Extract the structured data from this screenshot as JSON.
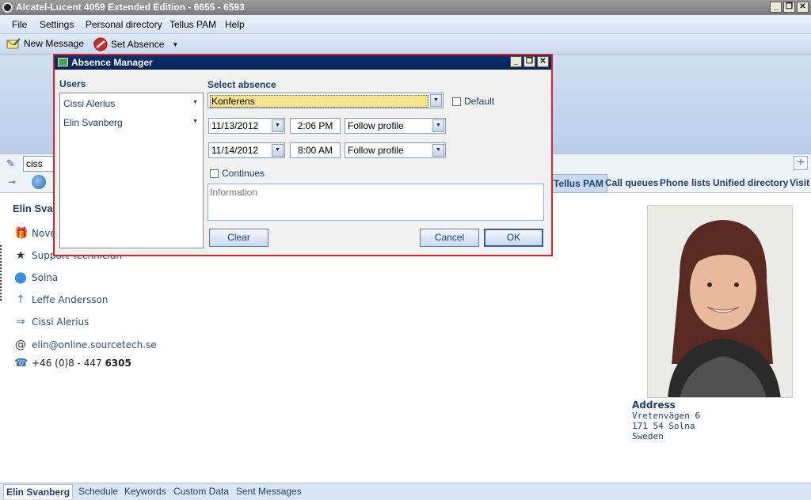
{
  "window": {
    "title": "Alcatel-Lucent 4059 Extended Edition - 6655 - 6593",
    "min": "_",
    "max": "❐",
    "close": "✕"
  },
  "menu": [
    "File",
    "Settings",
    "Personal directory",
    "Tellus PAM",
    "Help"
  ],
  "toolbar": {
    "new_message": "New Message",
    "set_absence": "Set Absence"
  },
  "search": {
    "value": "ciss"
  },
  "tabs": [
    "Tellus PAM",
    "Call queues",
    "Phone lists",
    "Unified directory",
    "Visit"
  ],
  "contact": {
    "name": "Elin Sva",
    "birthday": "Nove",
    "title": "Support Technician",
    "location": "Solna",
    "manager": "Leffe Andersson",
    "assistant": "Cissi Alerius",
    "email": "elin@online.sourcetech.se",
    "phone_prefix": "+46 (0)8 - 447 ",
    "phone_ext": "6305"
  },
  "address": {
    "title": "Address",
    "lines": [
      "Vretenvägen 6",
      "171 54 Solna",
      "Sweden"
    ]
  },
  "bottom_tabs": [
    "Elin Svanberg",
    "Schedule",
    "Keywords",
    "Custom Data",
    "Sent Messages"
  ],
  "dialog": {
    "title": "Absence Manager",
    "users_label": "Users",
    "users": [
      "Cissi Alerius",
      "Elin Svanberg"
    ],
    "select_absence_label": "Select absence",
    "absence_value": "Konferens",
    "default_label": "Default",
    "start_date": "11/13/2012",
    "start_time": "2:06 PM",
    "start_profile": "Follow profile",
    "end_date": "11/14/2012",
    "end_time": "8:00 AM",
    "end_profile": "Follow profile",
    "continues_label": "Continues",
    "info_placeholder": "Information",
    "clear_label": "Clear",
    "cancel_label": "Cancel",
    "ok_label": "OK"
  },
  "colors": {
    "dialog_border": "#d32525",
    "dialog_title_bg": "#0c2f6e",
    "highlight": "#fbe48a",
    "link_text": "#1d3e6e"
  }
}
